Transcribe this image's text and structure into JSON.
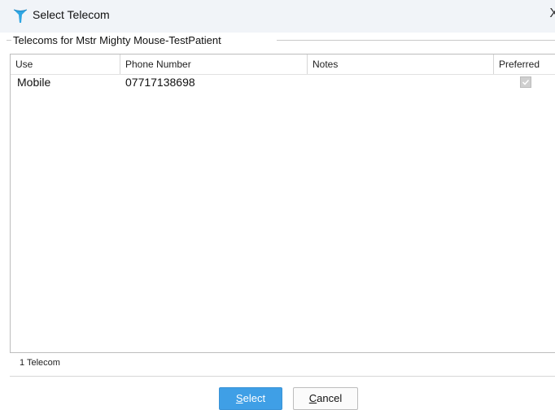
{
  "dialog": {
    "title": "Select Telecom",
    "close_label": "X",
    "accent": "#3f9fe6"
  },
  "group": {
    "legend": "Telecoms for Mstr Mighty Mouse-TestPatient"
  },
  "table": {
    "columns": [
      "Use",
      "Phone Number",
      "Notes",
      "Preferred"
    ],
    "rows": [
      {
        "use": "Mobile",
        "phone": "07717138698",
        "notes": "",
        "preferred": true
      }
    ]
  },
  "status": {
    "count_text": "1 Telecom"
  },
  "buttons": {
    "select": {
      "mnemonic": "S",
      "rest": "elect"
    },
    "cancel": {
      "mnemonic": "C",
      "rest": "ancel"
    }
  }
}
